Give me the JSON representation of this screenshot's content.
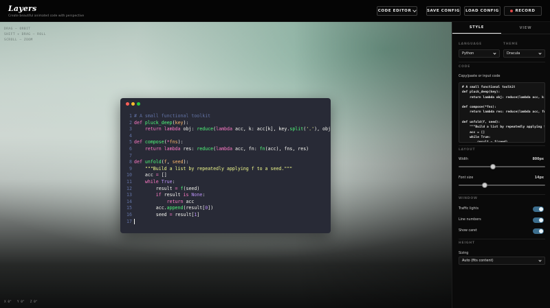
{
  "app": {
    "title": "Layers",
    "subtitle": "Create beautiful animated code with perspective"
  },
  "toolbar": {
    "code_editor": "CODE EDITOR",
    "save_config": "SAVE CONFIG",
    "load_config": "LOAD CONFIG",
    "record": "RECORD",
    "record_color": "#e04848"
  },
  "canvas": {
    "hints": [
      "DRAG — ORBIT",
      "SHIFT + DRAG — ROLL",
      "SCROLL — ZOOM"
    ],
    "coords": {
      "x": "X 0°",
      "y": "Y 0°",
      "z": "Z 0°"
    }
  },
  "code_window": {
    "traffic_colors": [
      "#ff5f57",
      "#febc2e",
      "#28c840"
    ],
    "line_numbers": [
      "1",
      "2",
      "3",
      "4",
      "5",
      "6",
      "7",
      "8",
      "9",
      "10",
      "11",
      "12",
      "13",
      "14",
      "15",
      "16",
      "17"
    ]
  },
  "panel": {
    "tabs": {
      "style": "STYLE",
      "view": "VIEW"
    },
    "language": {
      "label": "LANGUAGE",
      "value": "Python"
    },
    "theme": {
      "label": "THEME",
      "value": "Dracula"
    },
    "code": {
      "section": "CODE",
      "label": "Copy/paste or input code",
      "preview": "# A small functional toolkit\ndef pluck_deep(key):\n    return lambda obj: reduce(lambda acc, k: acc[k], key.split('.'), obj)\n\ndef compose(*fns):\n    return lambda res: reduce(lambda acc, fn: fn(acc), fns, res)\n\ndef unfold(f, seed):\n    \"\"\"Build a list by repeatedly applying f to a seed.\"\"\"\n    acc = []\n    while True:\n        result = f(seed)\n        if result is None:"
    },
    "layout": {
      "section": "LAYOUT",
      "width_label": "Width",
      "width_value": "800px",
      "width_fraction": 0.4,
      "font_label": "Font size",
      "font_value": "14px",
      "font_fraction": 0.3
    },
    "window": {
      "section": "WINDOW",
      "traffic_lights": "Traffic lights",
      "line_numbers": "Line numbers",
      "show_caret": "Show caret"
    },
    "height": {
      "section": "HEIGHT",
      "sizing_label": "Sizing",
      "sizing_value": "Auto (fits content)"
    }
  }
}
